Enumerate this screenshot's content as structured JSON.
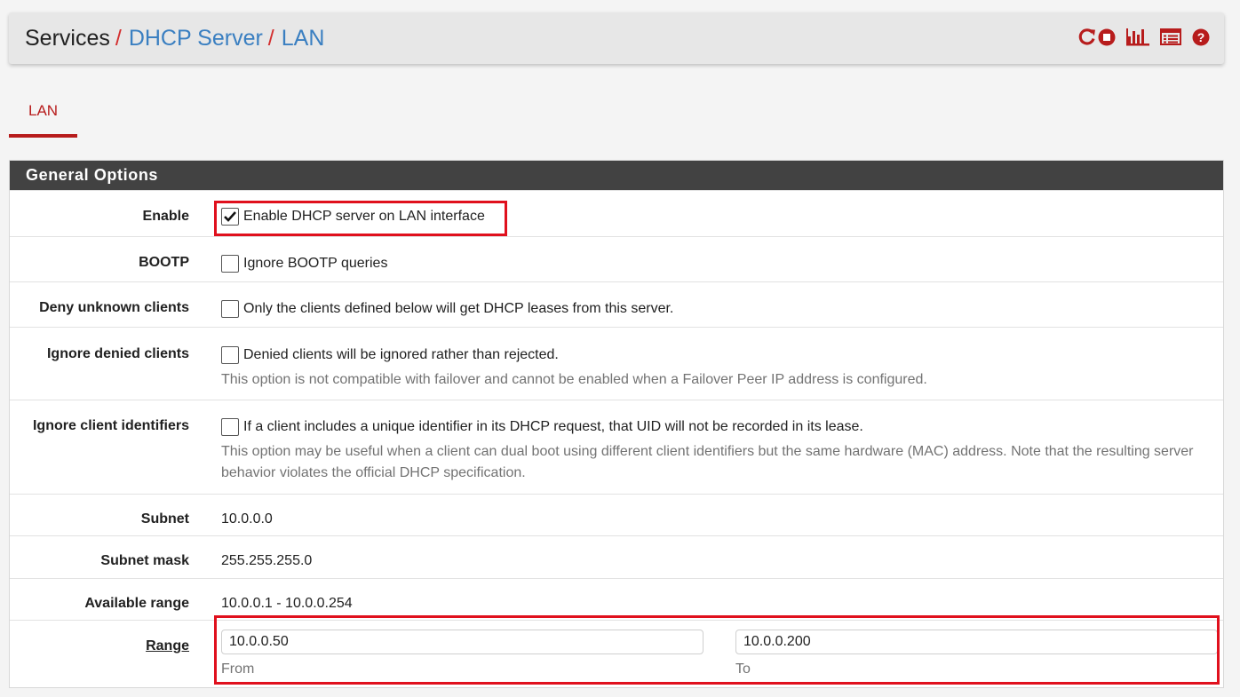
{
  "breadcrumb": {
    "items": [
      "Services",
      "DHCP Server",
      "LAN"
    ],
    "separator": "/"
  },
  "header_icons": [
    "restart-icon",
    "stop-icon",
    "bar-chart-icon",
    "list-icon",
    "help-icon"
  ],
  "tabs": [
    {
      "label": "LAN",
      "active": true
    }
  ],
  "panel": {
    "title": "General Options"
  },
  "fields": {
    "enable": {
      "label": "Enable",
      "checkbox_text": "Enable DHCP server on LAN interface",
      "checked": true
    },
    "bootp": {
      "label": "BOOTP",
      "checkbox_text": "Ignore BOOTP queries",
      "checked": false
    },
    "deny_unknown": {
      "label": "Deny unknown clients",
      "checkbox_text": "Only the clients defined below will get DHCP leases from this server.",
      "checked": false
    },
    "ignore_denied": {
      "label": "Ignore denied clients",
      "checkbox_text": "Denied clients will be ignored rather than rejected.",
      "checked": false,
      "help": "This option is not compatible with failover and cannot be enabled when a Failover Peer IP address is configured."
    },
    "ignore_client_ids": {
      "label": "Ignore client identifiers",
      "checkbox_text": "If a client includes a unique identifier in its DHCP request, that UID will not be recorded in its lease.",
      "checked": false,
      "help": "This option may be useful when a client can dual boot using different client identifiers but the same hardware (MAC) address. Note that the resulting server behavior violates the official DHCP specification."
    },
    "subnet": {
      "label": "Subnet",
      "value": "10.0.0.0"
    },
    "subnet_mask": {
      "label": "Subnet mask",
      "value": "255.255.255.0"
    },
    "available_range": {
      "label": "Available range",
      "value": "10.0.0.1 - 10.0.0.254"
    },
    "range": {
      "label": "Range",
      "from_value": "10.0.0.50",
      "from_label": "From",
      "to_value": "10.0.0.200",
      "to_label": "To"
    }
  },
  "colors": {
    "accent_red": "#b71c1c",
    "link_blue": "#3a7fc1",
    "heading_bg": "#424242",
    "highlight": "#e0101d"
  }
}
